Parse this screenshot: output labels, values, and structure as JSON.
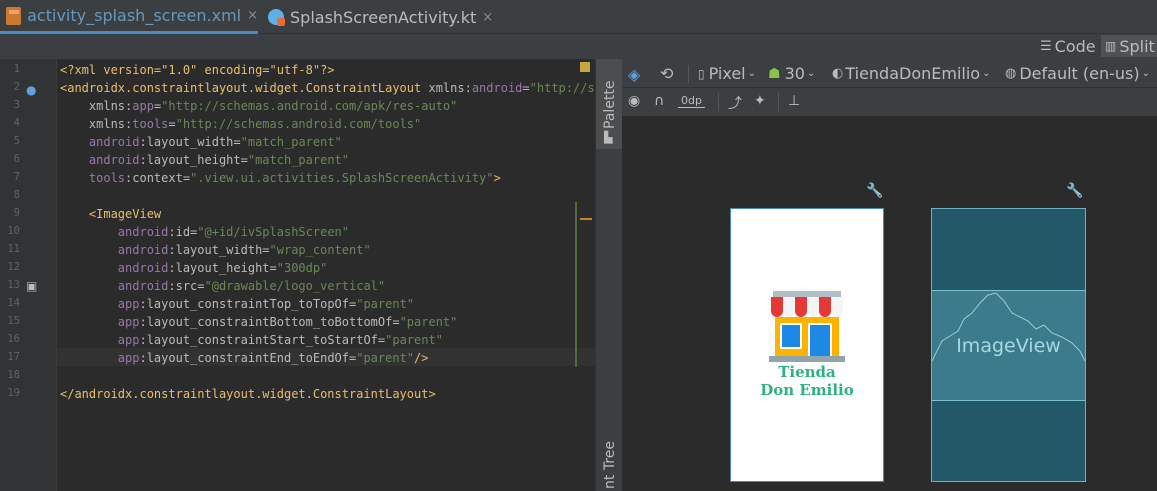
{
  "tabs": [
    {
      "label": "activity_splash_screen.xml",
      "close": "×"
    },
    {
      "label": "SplashScreenActivity.kt",
      "close": "×"
    }
  ],
  "view_modes": {
    "code": "Code",
    "split": "Split"
  },
  "gutter": {
    "line_numbers": [
      "1",
      "2",
      "3",
      "4",
      "5",
      "6",
      "7",
      "8",
      "9",
      "10",
      "11",
      "12",
      "13",
      "14",
      "15",
      "16",
      "17",
      "18",
      "19"
    ]
  },
  "code_lines": [
    {
      "n": 1,
      "parts": [
        [
          "p",
          "<?xml version=\"1.0\" encoding=\"utf-8\"?>"
        ]
      ]
    },
    {
      "n": 2,
      "parts": [
        [
          "t",
          "<androidx.constraintlayout.widget.ConstraintLayout "
        ],
        [
          "a",
          "xmlns:"
        ],
        [
          "ns",
          "android"
        ],
        [
          "a",
          "="
        ],
        [
          "v",
          "\"http://sch"
        ]
      ]
    },
    {
      "n": 3,
      "parts": [
        [
          "a",
          "    xmlns:"
        ],
        [
          "ns",
          "app"
        ],
        [
          "a",
          "="
        ],
        [
          "v",
          "\"http://schemas.android.com/apk/res-auto\""
        ]
      ]
    },
    {
      "n": 4,
      "parts": [
        [
          "a",
          "    xmlns:"
        ],
        [
          "ns",
          "tools"
        ],
        [
          "a",
          "="
        ],
        [
          "v",
          "\"http://schemas.android.com/tools\""
        ]
      ]
    },
    {
      "n": 5,
      "parts": [
        [
          "ns",
          "    android"
        ],
        [
          "a",
          ":layout_width="
        ],
        [
          "v",
          "\"match_parent\""
        ]
      ]
    },
    {
      "n": 6,
      "parts": [
        [
          "ns",
          "    android"
        ],
        [
          "a",
          ":layout_height="
        ],
        [
          "v",
          "\"match_parent\""
        ]
      ]
    },
    {
      "n": 7,
      "parts": [
        [
          "ns",
          "    tools"
        ],
        [
          "a",
          ":context="
        ],
        [
          "v",
          "\".view.ui.activities.SplashScreenActivity\""
        ],
        [
          "t",
          ">"
        ]
      ]
    },
    {
      "n": 8,
      "parts": []
    },
    {
      "n": 9,
      "parts": [
        [
          "t",
          "    <ImageView"
        ]
      ]
    },
    {
      "n": 10,
      "parts": [
        [
          "ns",
          "        android"
        ],
        [
          "a",
          ":id="
        ],
        [
          "v",
          "\"@+id/ivSplashScreen\""
        ]
      ]
    },
    {
      "n": 11,
      "parts": [
        [
          "ns",
          "        android"
        ],
        [
          "a",
          ":layout_width="
        ],
        [
          "v",
          "\"wrap_content\""
        ]
      ]
    },
    {
      "n": 12,
      "parts": [
        [
          "ns",
          "        android"
        ],
        [
          "a",
          ":layout_height="
        ],
        [
          "v",
          "\"300dp\""
        ]
      ]
    },
    {
      "n": 13,
      "parts": [
        [
          "ns",
          "        android"
        ],
        [
          "a",
          ":src="
        ],
        [
          "v",
          "\"@drawable/logo_vertical\""
        ]
      ]
    },
    {
      "n": 14,
      "parts": [
        [
          "ns",
          "        app"
        ],
        [
          "a",
          ":layout_constraintTop_toTopOf="
        ],
        [
          "v",
          "\"parent\""
        ]
      ]
    },
    {
      "n": 15,
      "parts": [
        [
          "ns",
          "        app"
        ],
        [
          "a",
          ":layout_constraintBottom_toBottomOf="
        ],
        [
          "v",
          "\"parent\""
        ]
      ]
    },
    {
      "n": 16,
      "parts": [
        [
          "ns",
          "        app"
        ],
        [
          "a",
          ":layout_constraintStart_toStartOf="
        ],
        [
          "v",
          "\"parent\""
        ]
      ]
    },
    {
      "n": 17,
      "parts": [
        [
          "ns",
          "        app"
        ],
        [
          "a",
          ":layout_constraintEnd_toEndOf="
        ],
        [
          "v",
          "\"parent\""
        ],
        [
          "t",
          "/>"
        ]
      ]
    },
    {
      "n": 18,
      "parts": []
    },
    {
      "n": 19,
      "parts": [
        [
          "t",
          "</androidx.constraintlayout.widget.ConstraintLayout>"
        ]
      ]
    }
  ],
  "side_panels": {
    "palette": "Palette",
    "component_tree": "nt Tree"
  },
  "design_toolbar": {
    "device": "Pixel",
    "api": "30",
    "theme": "TiendaDonEmilio",
    "locale": "Default (en-us)",
    "margin": "0dp"
  },
  "preview": {
    "logo_line1": "Tienda",
    "logo_line2": "Don Emilio",
    "blueprint_label": "ImageView"
  },
  "colors": {
    "accent": "#4a88c7",
    "blueprint": "#225868",
    "logo_green": "#2fb37e"
  }
}
